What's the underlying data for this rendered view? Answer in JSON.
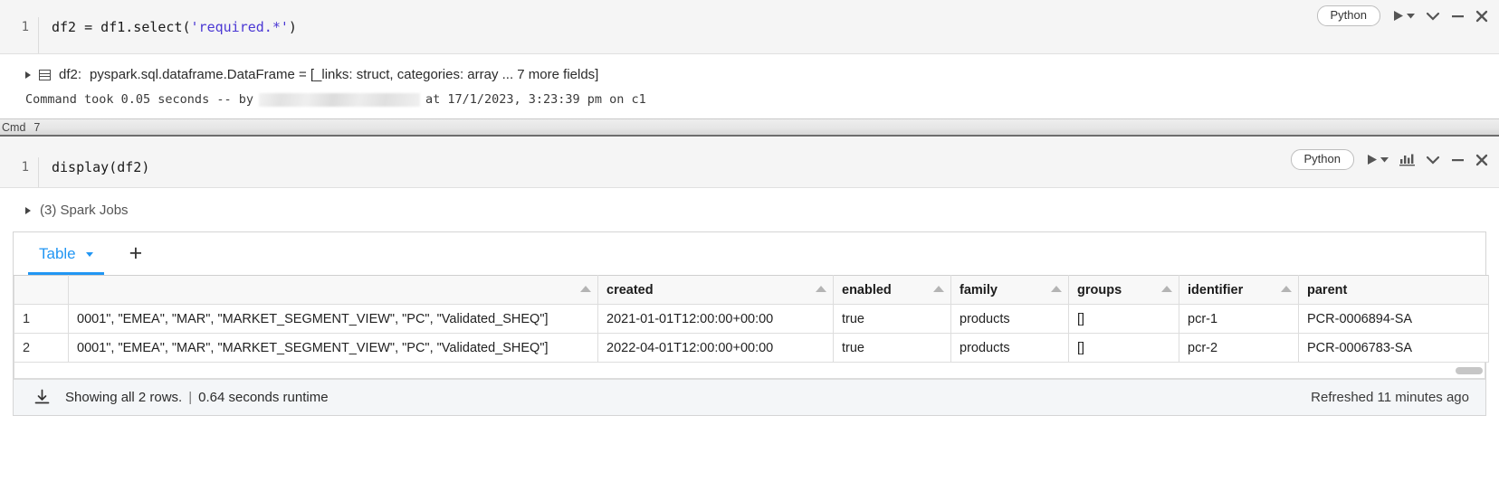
{
  "cell1": {
    "line_number": "1",
    "code_prefix": "df2 = df1.select(",
    "code_string": "'required.*'",
    "code_suffix": ")",
    "language": "Python",
    "result": {
      "var_label": "df2:",
      "var_type": "pyspark.sql.dataframe.DataFrame = [_links: struct, categories: array ... 7 more fields]"
    },
    "status": {
      "prefix": "Command took 0.05 seconds -- by",
      "suffix": "at 17/1/2023, 3:23:39 pm on c1"
    }
  },
  "divider": {
    "label": "Cmd",
    "number": "7"
  },
  "cell2": {
    "line_number": "1",
    "code": "display(df2)",
    "language": "Python",
    "spark_jobs": "(3) Spark Jobs",
    "viz": {
      "tab_label": "Table",
      "add_label": "+",
      "columns": [
        "",
        "created",
        "enabled",
        "family",
        "groups",
        "identifier",
        "parent"
      ],
      "rows": [
        {
          "index": "1",
          "cells": [
            "0001\", \"EMEA\", \"MAR\", \"MARKET_SEGMENT_VIEW\", \"PC\", \"Validated_SHEQ\"]",
            "2021-01-01T12:00:00+00:00",
            "true",
            "products",
            "[]",
            "pcr-1",
            "PCR-0006894-SA"
          ]
        },
        {
          "index": "2",
          "cells": [
            "0001\", \"EMEA\", \"MAR\", \"MARKET_SEGMENT_VIEW\", \"PC\", \"Validated_SHEQ\"]",
            "2022-04-01T12:00:00+00:00",
            "true",
            "products",
            "[]",
            "pcr-2",
            "PCR-0006783-SA"
          ]
        }
      ],
      "footer": {
        "rows_text": "Showing all 2 rows.",
        "separator": "|",
        "runtime_text": "0.64 seconds runtime",
        "refreshed_text": "Refreshed 11 minutes ago"
      }
    }
  },
  "icons": {
    "run": "play-icon",
    "run_dropdown": "caret-down-icon",
    "chart": "bar-chart-icon",
    "collapse": "chevron-down-icon",
    "minimize": "minus-icon",
    "close": "close-icon",
    "download": "download-icon",
    "expand": "expand-triangle-icon",
    "table": "table-grid-icon"
  }
}
